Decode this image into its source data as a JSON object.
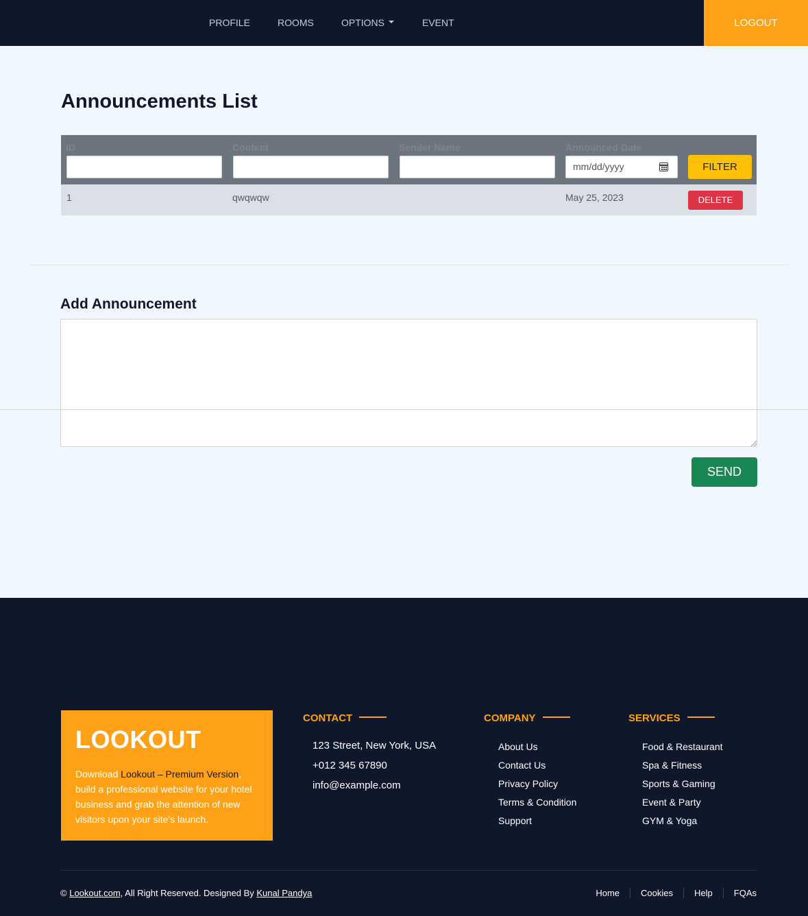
{
  "nav": {
    "items": [
      "PROFILE",
      "ROOMS",
      "OPTIONS",
      "EVENT"
    ],
    "logout": "LOGOUT"
  },
  "announcements": {
    "title": "Announcements List",
    "columns": [
      "ID",
      "Content",
      "Sender Name",
      "Announced Date"
    ],
    "date_placeholder": "mm/dd/yyyy",
    "filter_label": "FILTER",
    "rows": [
      {
        "id": "1",
        "content": "qwqwqw",
        "sender": "",
        "date": "May 25, 2023",
        "action": "DELETE"
      }
    ]
  },
  "add_announcement": {
    "title": "Add Announcement",
    "content_value": "",
    "send_label": "SEND"
  },
  "footer": {
    "brand": "LOOKOUT",
    "brand_text_pre": "Download ",
    "brand_link": "Lookout – Premium Version",
    "brand_text_post": ", build a professional website for your hotel business and grab the attention of new visitors upon your site's launch.",
    "contact_heading": "CONTACT",
    "contact": [
      "123 Street, New York, USA",
      "+012 345 67890",
      "info@example.com"
    ],
    "company_heading": "COMPANY",
    "company": [
      "About Us",
      "Contact Us",
      "Privacy Policy",
      "Terms & Condition",
      "Support"
    ],
    "services_heading": "SERVICES",
    "services": [
      "Food & Restaurant",
      "Spa & Fitness",
      "Sports & Gaming",
      "Event & Party",
      "GYM & Yoga"
    ],
    "copyright_symbol": "©",
    "copyright_site": "Lookout.com",
    "copyright_text": ", All Right Reserved. Designed By ",
    "copyright_designer": "Kunal Pandya",
    "bottom_menu": [
      "Home",
      "Cookies",
      "Help",
      "FQAs"
    ]
  },
  "colors": {
    "navy": "#0f172b",
    "accent": "#fea116",
    "filter": "#ffc107",
    "delete": "#dc3545",
    "send": "#198754"
  }
}
